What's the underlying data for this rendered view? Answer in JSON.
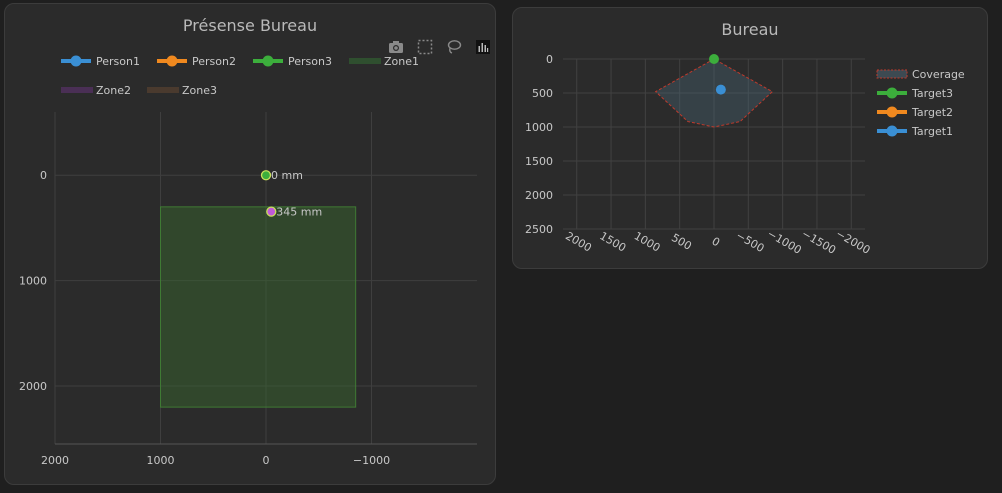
{
  "card1": {
    "title": "Présense Bureau",
    "toolbar": [
      "camera-icon",
      "box-select-icon",
      "lasso-icon",
      "chart-bars-icon"
    ],
    "legend": [
      {
        "label": "Person1",
        "color": "#3a8fd4",
        "kind": "line"
      },
      {
        "label": "Person2",
        "color": "#f0891f",
        "kind": "line"
      },
      {
        "label": "Person3",
        "color": "#3cae3c",
        "kind": "line"
      },
      {
        "label": "Zone1",
        "color": "#2f4f2f",
        "kind": "rect"
      },
      {
        "label": "Zone2",
        "color": "#4a2f55",
        "kind": "rect"
      },
      {
        "label": "Zone3",
        "color": "#4a3a2e",
        "kind": "rect"
      }
    ]
  },
  "card2": {
    "title": "Bureau",
    "legend": [
      {
        "label": "Coverage",
        "color": "#c0392b",
        "kind": "dash"
      },
      {
        "label": "Target3",
        "color": "#3cae3c",
        "kind": "line"
      },
      {
        "label": "Target2",
        "color": "#f0891f",
        "kind": "line"
      },
      {
        "label": "Target1",
        "color": "#3a8fd4",
        "kind": "line"
      }
    ]
  },
  "chart_data": [
    {
      "type": "scatter",
      "title": "Présense Bureau",
      "x_ticks": [
        "2000",
        "1000",
        "0",
        "−1000"
      ],
      "y_ticks": [
        "0",
        "1000",
        "2000"
      ],
      "xlim": [
        2000,
        -2000
      ],
      "ylim": [
        -600,
        2550
      ],
      "x_reversed": true,
      "y_reversed": true,
      "grid": true,
      "legend_position": "top",
      "zones": [
        {
          "name": "Zone1",
          "x": [
            -850,
            1000
          ],
          "y": [
            300,
            2200
          ],
          "fill": "#3a6b2f"
        }
      ],
      "points": [
        {
          "name": "Person3",
          "x": 0,
          "y": 0,
          "color": "#3cae3c",
          "label": "0 mm"
        },
        {
          "name": "Person2",
          "x": -50,
          "y": 345,
          "color": "#c05ad8",
          "label": "345 mm"
        }
      ]
    },
    {
      "type": "scatter",
      "title": "Bureau",
      "x_ticks": [
        "2000",
        "1500",
        "1000",
        "500",
        "0",
        "−500",
        "−1000",
        "−1500",
        "−2000"
      ],
      "y_ticks": [
        "0",
        "500",
        "1000",
        "1500",
        "2000",
        "2500"
      ],
      "xlim": [
        2200,
        -2200
      ],
      "ylim": [
        0,
        2500
      ],
      "x_reversed": true,
      "y_reversed": true,
      "grid": true,
      "legend_position": "right",
      "coverage": {
        "name": "Coverage",
        "x": [
          0,
          850,
          380,
          0,
          -380,
          -850,
          0
        ],
        "y": [
          0,
          480,
          920,
          1000,
          920,
          480,
          0
        ]
      },
      "points": [
        {
          "name": "Target3",
          "x": 0,
          "y": 0,
          "color": "#3cae3c"
        },
        {
          "name": "Target1",
          "x": -100,
          "y": 450,
          "color": "#3a8fd4"
        }
      ]
    }
  ]
}
